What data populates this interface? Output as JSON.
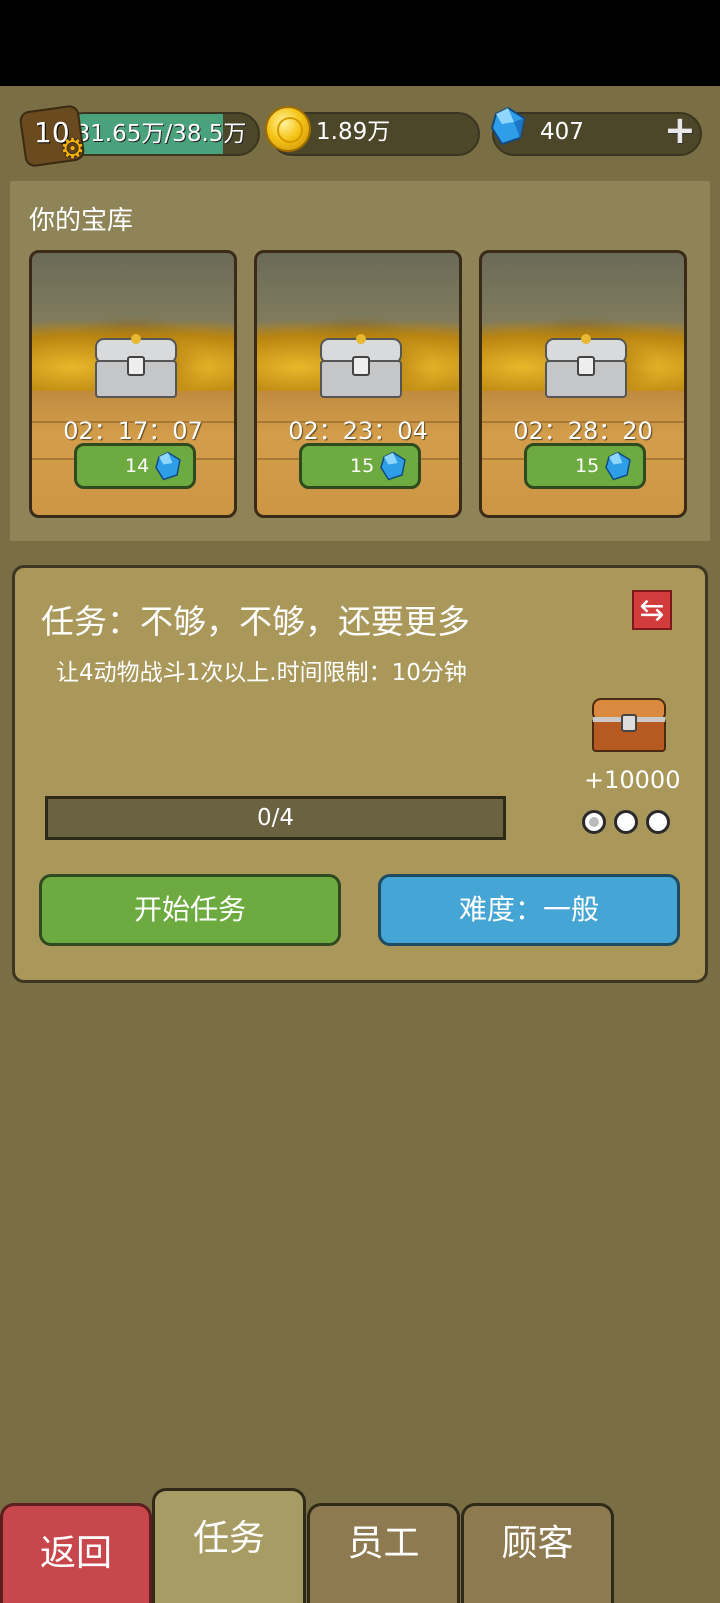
{
  "topbar": {
    "level": "10",
    "xp_text": "31.65万/38.5万",
    "xp_progress": 0.82,
    "coins": "1.89万",
    "gems": "407"
  },
  "vault": {
    "title": "你的宝库",
    "chests": [
      {
        "timer": "02：17：07",
        "cost": "14"
      },
      {
        "timer": "02：23：04",
        "cost": "15"
      },
      {
        "timer": "02：28：20",
        "cost": "15"
      }
    ]
  },
  "mission": {
    "title": "任务：不够，不够，还要更多",
    "description": "让4动物战斗1次以上.时间限制：10分钟",
    "reward": "+10000",
    "progress_text": "0/4",
    "progress": 0,
    "stars": [
      true,
      false,
      false
    ],
    "start_label": "开始任务",
    "difficulty_label": "难度：一般"
  },
  "tabs": {
    "back": "返回",
    "mission": "任务",
    "staff": "员工",
    "customer": "顾客"
  },
  "colors": {
    "background": "#7a6e45",
    "green_button": "#6dab40",
    "blue_button": "#45a5d4",
    "red_tab": "#c8474c"
  }
}
